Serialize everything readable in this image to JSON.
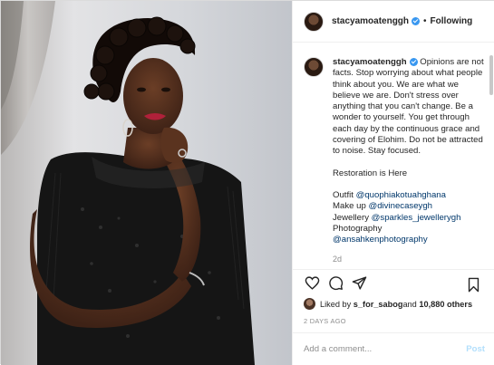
{
  "header": {
    "username": "stacyamoatenggh",
    "separator": "•",
    "follow_state": "Following"
  },
  "caption": {
    "username": "stacyamoatenggh",
    "paragraph": "Opinions are not facts. Stop worrying about what people think about you. We are what we believe we are. Don't stress over anything that you can't change. Be a wonder to yourself. You get through each day by the continuous grace and covering of Elohim. Do not be attracted to noise. Stay focused.",
    "restoration": "Restoration is Here",
    "credits": [
      {
        "label": "Outfit ",
        "mention": "@quophiakotuahghana"
      },
      {
        "label": "Make up ",
        "mention": "@divinecaseygh"
      },
      {
        "label": "Jewellery ",
        "mention": "@sparkles_jewellerygh"
      }
    ],
    "photography_label": "Photography",
    "photography_mention": "@ansahkenphotography",
    "time": "2d"
  },
  "actions": {
    "icons": [
      "heart-icon",
      "comment-icon",
      "share-icon",
      "bookmark-icon"
    ]
  },
  "likes": {
    "prefix": "Liked by ",
    "user": "s_for_sabog",
    "middle": " and ",
    "others": "10,880 others"
  },
  "posted_ago": "2 DAYS AGO",
  "comment": {
    "placeholder": "Add a comment...",
    "post_label": "Post"
  },
  "colors": {
    "verified": "#3897f0",
    "mention": "#00376b",
    "post_disabled": "#b2dffc",
    "dress": "#151515"
  }
}
